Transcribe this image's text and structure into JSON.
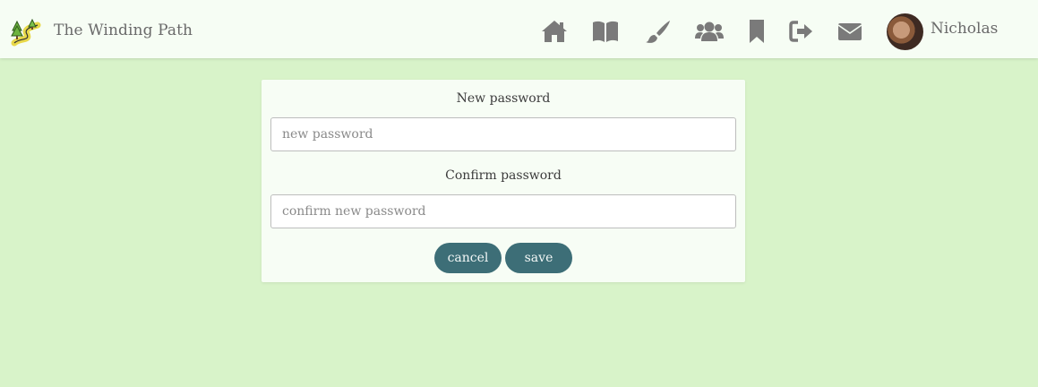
{
  "header": {
    "brand": "The Winding Path",
    "username": "Nicholas",
    "nav_icons": [
      "home-icon",
      "book-icon",
      "paintbrush-icon",
      "users-icon",
      "bookmark-icon",
      "sign-out-icon",
      "envelope-icon"
    ]
  },
  "form": {
    "new_password_label": "New password",
    "new_password_placeholder": "new password",
    "new_password_value": "",
    "confirm_password_label": "Confirm password",
    "confirm_password_placeholder": "confirm new password",
    "confirm_password_value": "",
    "cancel_label": "cancel",
    "save_label": "save"
  },
  "colors": {
    "page_background": "#d8f3c9",
    "header_background": "#f6fdf4",
    "button": "#3d6e77",
    "icon": "#7a7a7a"
  }
}
